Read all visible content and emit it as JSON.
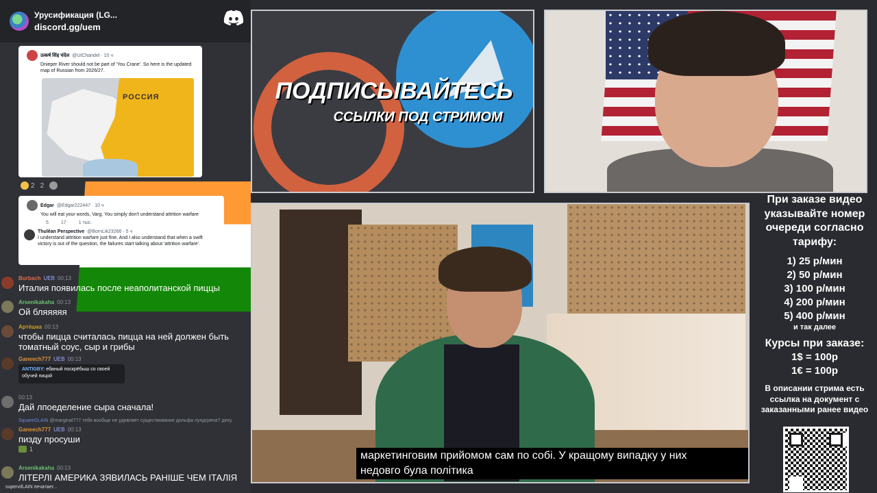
{
  "discord": {
    "server_name": "Урусификация (LG...",
    "invite": "discord.gg/uem",
    "tweets": [
      {
        "name": "उत्कर्ष सिंह चंदेल",
        "handle": "@UtChandel · 10 ч",
        "text": "Dnieper River should not be part of 'You Crane'. So here is the updated map of Russian from 2026/27.",
        "map_label": "РОССИЯ"
      },
      {
        "name": "Edgar",
        "handle": "@Edgar222447 · 10 ч",
        "text": "You will eat your words, Varg. You simply don't understand attrition warfare",
        "stats": [
          "5",
          "17",
          "1 тыс."
        ],
        "reply_name": "Thulêan Perspective",
        "reply_handle": "@BornLik23266 · 5 ч",
        "reply_text": "I understand attrition warfare just fine. And I also understand that when a swift victory is out of the question, the failures start talking about 'attrition warfare'."
      }
    ],
    "reactions": [
      {
        "emoji": "grinning-emoji",
        "count": "2"
      },
      {
        "emoji": "india-flag-emoji",
        "count": "2"
      }
    ],
    "messages": [
      {
        "author": "Burbach",
        "color": "#e06c4a",
        "badge": "UEB",
        "time": "00:13",
        "text": "Италия появилась после неаполитанской пиццы"
      },
      {
        "author": "Arsenikakaha",
        "color": "#6fbf73",
        "badge": "",
        "time": "00:13",
        "text": "Ой бляяяяя"
      },
      {
        "author": "Артёшка",
        "color": "#c9a227",
        "badge": "",
        "time": "00:13",
        "text": "чтобы пицца считалась пицца на ней должен быть томатный соус, сыр и грибы"
      },
      {
        "author": "Ganeech777",
        "color": "#e0913a",
        "badge": "UEB",
        "time": "00:13",
        "quote_author": "ANTIGBY:",
        "quote_text": "ебаный поскрёбыш со своей обучей пицой"
      },
      {
        "author": "",
        "color": "#dcddde",
        "badge": "",
        "time": "00:13",
        "text": "Дай лпоеделение сыра сначала!"
      },
      {
        "author": "Ganeech777",
        "color": "#e0913a",
        "badge": "UEB",
        "time": "00:13",
        "text": "пизду просуши",
        "reply": "@marginal777 тебя вообще не удивляет существование дольфа лундгрена? деху.",
        "reply_author": "SquareGLAIN"
      },
      {
        "author": "Arsenikakaha",
        "color": "#6fbf73",
        "badge": "",
        "time": "00:13",
        "text": "ЛІТЕРЛІ АМЕРИКА ЗЯВИЛАСЬ РАНІШЕ ЧЕМ ІТАЛІЯ"
      }
    ],
    "reaction_small": "1",
    "typing": "supervilLAIN печатает..."
  },
  "banner": {
    "title": "ПОДПИСЫВАЙТЕСЬ",
    "subtitle": "ССЫЛКИ ПОД СТРИМОМ"
  },
  "video": {
    "subtitle_line1": "маркетинговим прийомом сам по собі. У кращому випадку у них",
    "subtitle_line2": "недовго була політика"
  },
  "info": {
    "title": "При заказе видео указывайте номер очереди согласно тарифу:",
    "tariffs": [
      "1) 25 р/мин",
      "2) 50 р/мин",
      "3) 100 р/мин",
      "4) 200 р/мин",
      "5) 400 р/мин"
    ],
    "tariff_note": "и так далее",
    "rates_title": "Курсы при заказе:",
    "rates": [
      "1$ = 100р",
      "1€ = 100р"
    ],
    "doc_note": "В описании стрима есть ссылка на документ с заказанными ранее видео"
  },
  "colors": {
    "chat_bg": "#2f3136",
    "header_bg": "#232428",
    "stream_bg": "#2a2b30",
    "banner_orange": "#d1613f",
    "banner_blue": "#2e8fd1"
  }
}
